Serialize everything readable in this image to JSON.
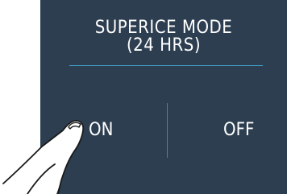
{
  "mode_panel": {
    "title_line1": "SUPERICE MODE",
    "title_line2": "(24 HRS)",
    "on_label": "ON",
    "off_label": "OFF"
  },
  "colors": {
    "panel_background": "#2d3e50",
    "divider": "#3fa0c8",
    "text": "#ffffff"
  },
  "icons": {
    "pointer": "pointing-hand-icon"
  }
}
